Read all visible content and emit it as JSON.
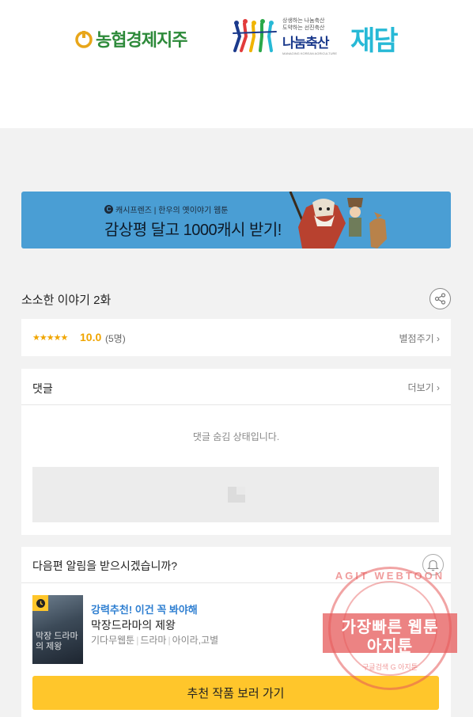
{
  "sponsors": {
    "nh": "농협경제지주",
    "share_small1": "상생하는 나눔축산",
    "share_small2": "도약하는 선진축산",
    "share_main": "나눔축산",
    "share_tiny": "MANAGING KOREAN AGRICULTURE",
    "jaedam": "재담"
  },
  "banner": {
    "badge": "C",
    "subtitle": "캐시프렌즈 | 한우의 옛이야기 웹툰",
    "main": "감상평 달고 1000캐시 받기!"
  },
  "episode": {
    "title": "소소한 이야기 2화"
  },
  "rating": {
    "stars": "★★★★★",
    "score": "10.0",
    "count": "(5명)",
    "action": "별점주기 ›"
  },
  "comments": {
    "title": "댓글",
    "more": "더보기 ›",
    "hidden_msg": "댓글 숨김 상태입니다."
  },
  "notify": {
    "question": "다음편 알림을 받으시겠습니까?",
    "tag": "강력추천! 이건 꼭 봐야해",
    "title": "막장드라마의 제왕",
    "meta_platform": "기다무웹툰",
    "meta_genre": "드라마",
    "meta_authors": "아이라,고별",
    "thumb_text": "막장 드라마의 제왕",
    "cta": "추천 작품 보러 가기"
  },
  "watermark": {
    "top": "AGIT WEBTOON",
    "line1": "가장빠른 웹툰",
    "line2": "아지툰",
    "bottom": "구글검색  G  아지툰"
  },
  "colors": {
    "accent": "#ffc62b",
    "banner": "#4a9ed4",
    "star": "#f0a500",
    "link_blue": "#2f7fd1"
  }
}
